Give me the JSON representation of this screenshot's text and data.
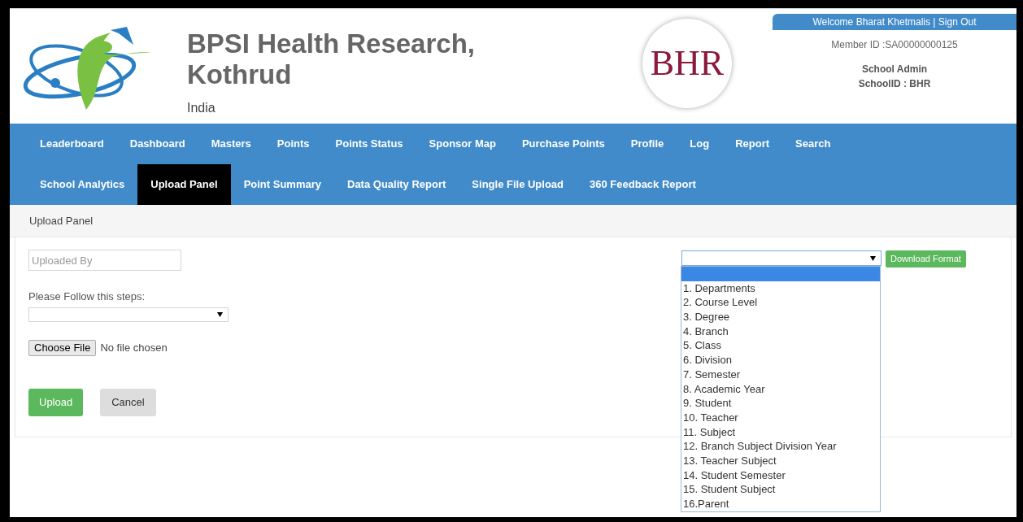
{
  "header": {
    "title_line_1": "BPSI Health Research,",
    "title_line_2": "Kothrud",
    "country": "India",
    "badge_logo_text": "BHR",
    "welcome": "Welcome Bharat Khetmalis | Sign Out",
    "member_id": "Member ID :SA00000000125",
    "role": "School Admin",
    "school_id": "SchoolID : BHR"
  },
  "nav_rows": [
    [
      {
        "label": "Leaderboard",
        "selected": false
      },
      {
        "label": "Dashboard",
        "selected": false
      },
      {
        "label": "Masters",
        "selected": false
      },
      {
        "label": "Points",
        "selected": false
      },
      {
        "label": "Points Status",
        "selected": false
      },
      {
        "label": "Sponsor Map",
        "selected": false
      },
      {
        "label": "Purchase Points",
        "selected": false
      },
      {
        "label": "Profile",
        "selected": false
      },
      {
        "label": "Log",
        "selected": false
      },
      {
        "label": "Report",
        "selected": false
      },
      {
        "label": "Search",
        "selected": false
      }
    ],
    [
      {
        "label": "School Analytics",
        "selected": false
      },
      {
        "label": "Upload Panel",
        "selected": true
      },
      {
        "label": "Point Summary",
        "selected": false
      },
      {
        "label": "Data Quality Report",
        "selected": false
      },
      {
        "label": "Single File Upload",
        "selected": false
      },
      {
        "label": "360 Feedback Report",
        "selected": false
      }
    ]
  ],
  "breadcrumb": "Upload Panel",
  "form": {
    "uploaded_by": {
      "placeholder": "Uploaded By"
    },
    "steps_label": "Please Follow this steps:",
    "choose_file_button": "Choose File",
    "file_status": "No file chosen",
    "upload_button": "Upload",
    "cancel_button": "Cancel"
  },
  "format_dropdown": {
    "expanded": true,
    "download_button": "Download Format",
    "options": [
      {
        "selected": true
      },
      {
        "label": "1. Departments",
        "selected": false
      },
      {
        "label": "2. Course Level",
        "selected": false
      },
      {
        "label": "3. Degree",
        "selected": false
      },
      {
        "label": "4. Branch",
        "selected": false
      },
      {
        "label": "5. Class",
        "selected": false
      },
      {
        "label": "6. Division",
        "selected": false
      },
      {
        "label": "7. Semester",
        "selected": false
      },
      {
        "label": "8. Academic Year",
        "selected": false
      },
      {
        "label": "9. Student",
        "selected": false
      },
      {
        "label": "10. Teacher",
        "selected": false
      },
      {
        "label": "11. Subject",
        "selected": false
      },
      {
        "label": "12. Branch Subject Division Year",
        "selected": false
      },
      {
        "label": "13. Teacher Subject",
        "selected": false
      },
      {
        "label": "14. Student Semester",
        "selected": false
      },
      {
        "label": "15. Student Subject",
        "selected": false
      },
      {
        "label": "16.Parent",
        "selected": false
      }
    ]
  }
}
